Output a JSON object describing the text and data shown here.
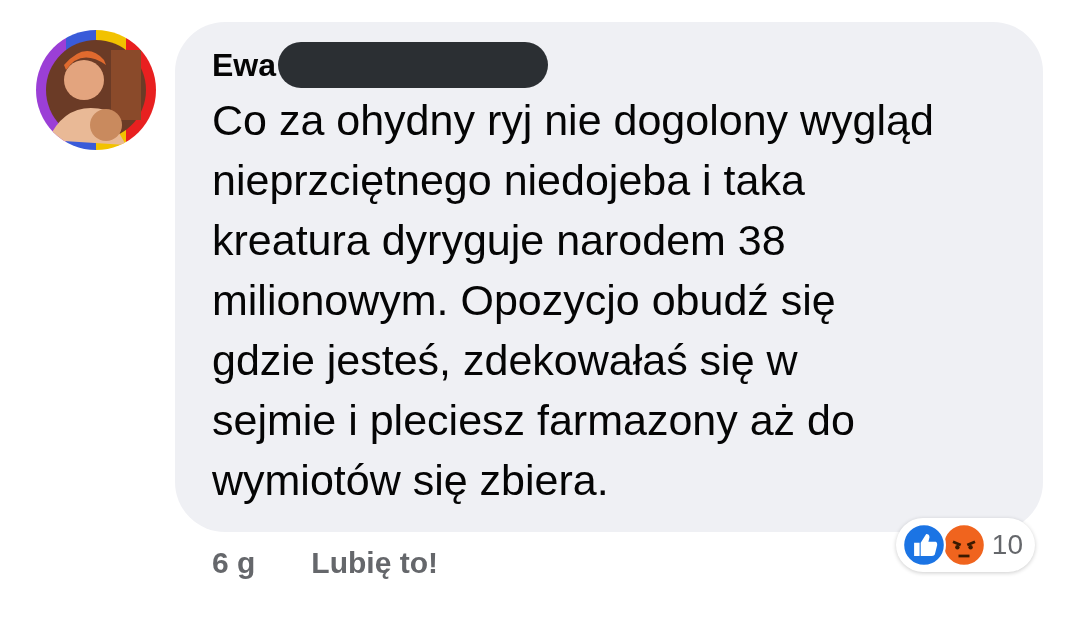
{
  "comment": {
    "author": "Ewa",
    "author_redacted": true,
    "text_lines": [
      "Co za ohydny ryj nie dogolony wygląd",
      "nieprzciętnego niedojeba i taka",
      "kreatura dyryguje narodem 38",
      "milionowym. Opozycjo obudź się",
      "gdzie jesteś, zdekowałaś się w",
      "sejmie i pleciesz farmazony aż do",
      "wymiotów się zbiera."
    ],
    "time": "6 g",
    "like_label": "Lubię to!",
    "reactions": {
      "icons": [
        {
          "kind": "like"
        },
        {
          "kind": "angry"
        }
      ],
      "count": "10"
    }
  }
}
